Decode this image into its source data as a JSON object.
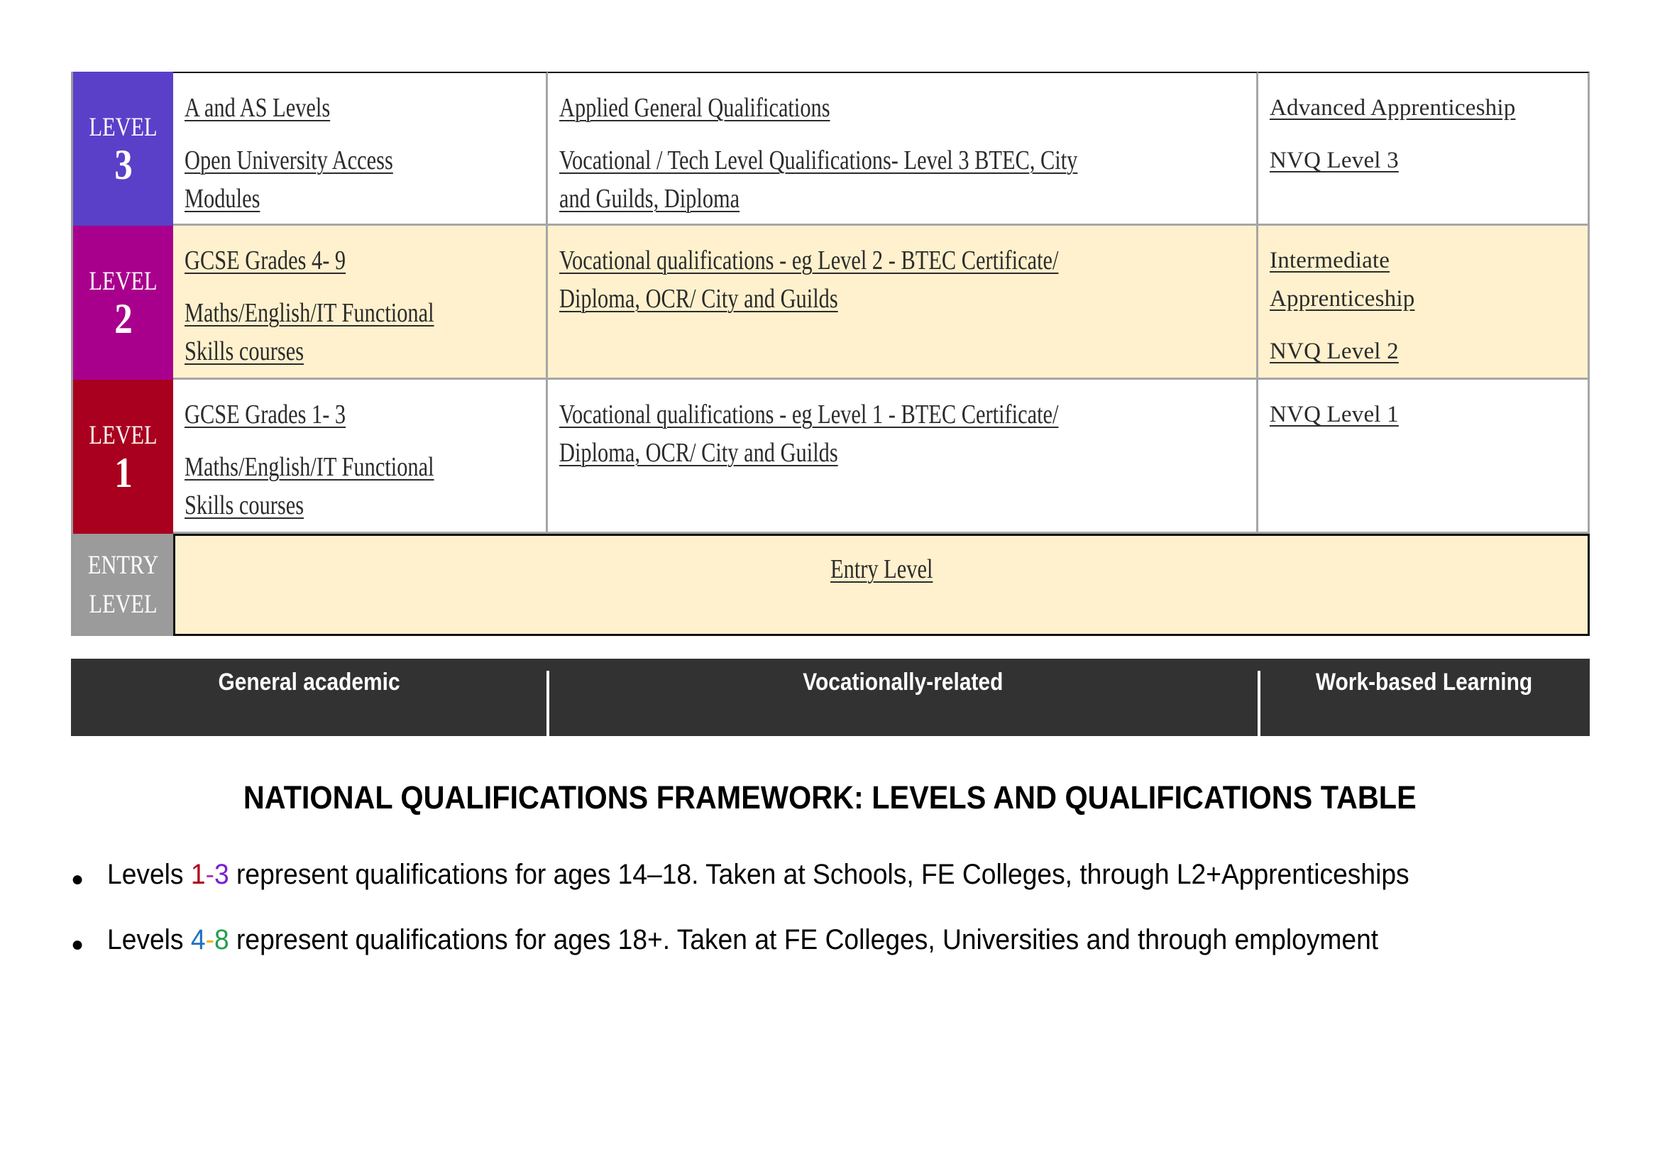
{
  "table": {
    "rows": [
      {
        "level_word": "LEVEL",
        "level_num": "3",
        "color": "#5a40c8",
        "background": "white",
        "general_academic": [
          "A and AS Levels",
          "Open University Access Modules"
        ],
        "vocational": [
          "Applied General Qualifications",
          "Vocational / Tech Level Qualifications- Level 3 BTEC, City and Guilds, Diploma"
        ],
        "work_based": [
          "Advanced Apprenticeship",
          "NVQ Level 3"
        ]
      },
      {
        "level_word": "LEVEL",
        "level_num": "2",
        "color": "#a8008c",
        "background": "cream",
        "general_academic": [
          "GCSE Grades 4- 9",
          "Maths/English/IT Functional Skills courses"
        ],
        "vocational": [
          "Vocational qualifications - eg Level 2 - BTEC Certificate/ Diploma, OCR/ City and Guilds"
        ],
        "work_based": [
          "Intermediate Apprenticeship",
          "NVQ Level 2"
        ]
      },
      {
        "level_word": "LEVEL",
        "level_num": "1",
        "color": "#a8001e",
        "background": "white",
        "general_academic": [
          "GCSE Grades 1- 3",
          "Maths/English/IT Functional Skills courses"
        ],
        "vocational": [
          "Vocational qualifications - eg Level 1 - BTEC Certificate/ Diploma, OCR/ City and Guilds"
        ],
        "work_based": [
          "NVQ Level 1"
        ]
      }
    ],
    "entry": {
      "label_line1": "ENTRY",
      "label_line2": "LEVEL",
      "color": "#9b9b9b",
      "item": "Entry Level"
    },
    "colors": {
      "cream": "#fff1cd",
      "footer": "#323232"
    }
  },
  "footer": {
    "columns": [
      "General academic",
      "Vocationally-related",
      "Work-based Learning"
    ]
  },
  "title": "NATIONAL QUALIFICATIONS FRAMEWORK: LEVELS AND QUALIFICATIONS TABLE",
  "bullets": [
    {
      "prefix": "Levels ",
      "range_start": "1",
      "range_sep": "-",
      "range_end": "3",
      "range_colors": [
        "#b0001c",
        "#b03cb8",
        "#7a1fd1"
      ],
      "suffix": " represent qualifications for ages 14–18. Taken at Schools, FE Colleges, through L2+Apprenticeships"
    },
    {
      "prefix": "Levels ",
      "range_start": "4",
      "range_sep": "-",
      "range_end": "8",
      "range_colors": [
        "#1f6fc0",
        "#f0b400",
        "#1fa050"
      ],
      "suffix": " represent qualifications for ages 18+. Taken at FE Colleges, Universities and through employment"
    }
  ]
}
